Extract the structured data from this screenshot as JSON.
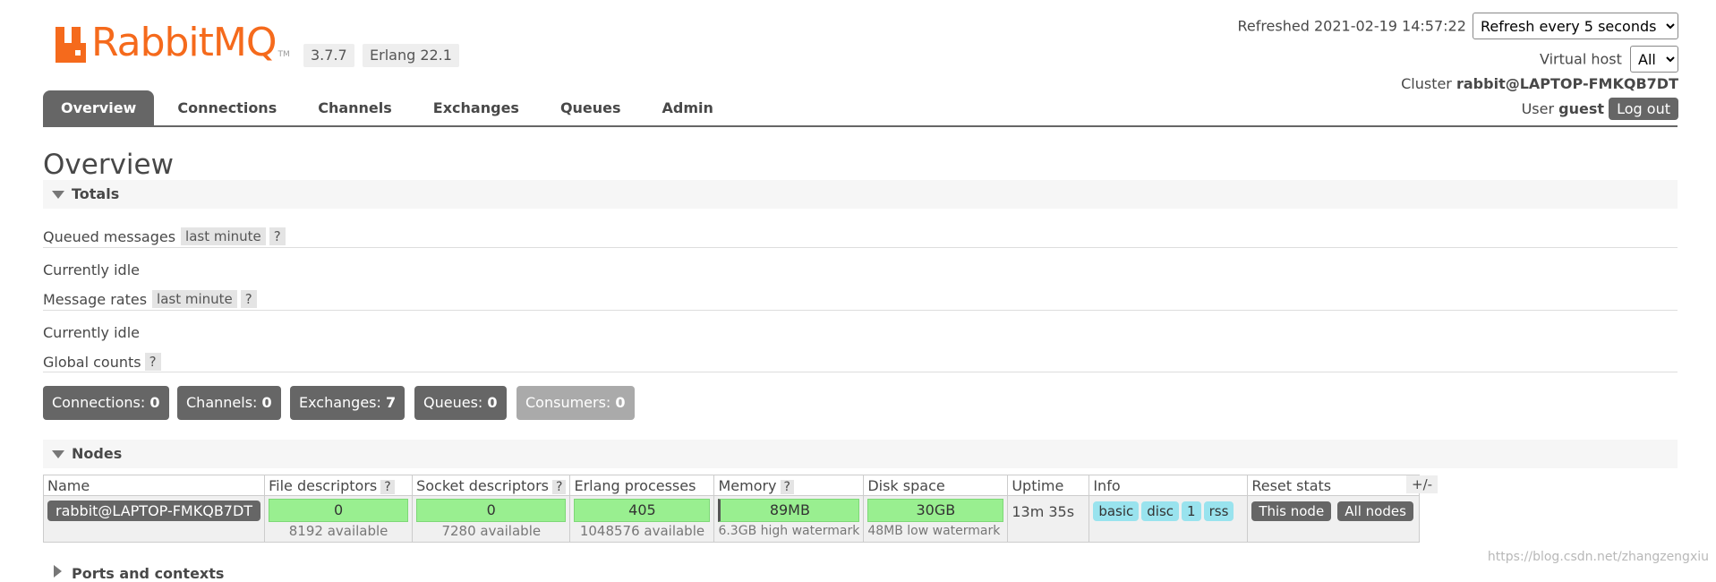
{
  "brand": {
    "name": "RabbitMQ",
    "tm": "TM",
    "version": "3.7.7",
    "erlang": "Erlang 22.1",
    "color": "#f56a1c"
  },
  "header": {
    "refreshed_label": "Refreshed",
    "refreshed_time": "2021-02-19 14:57:22",
    "refresh_select": "Refresh every 5 seconds",
    "vhost_label": "Virtual host",
    "vhost_select": "All",
    "cluster_label": "Cluster",
    "cluster_name": "rabbit@LAPTOP-FMKQB7DT",
    "user_label": "User",
    "user_name": "guest",
    "logout": "Log out"
  },
  "tabs": [
    "Overview",
    "Connections",
    "Channels",
    "Exchanges",
    "Queues",
    "Admin"
  ],
  "page_title": "Overview",
  "totals": {
    "title": "Totals",
    "queued_messages": "Queued messages",
    "queued_range": "last minute",
    "queued_help": "?",
    "queued_status": "Currently idle",
    "message_rates": "Message rates",
    "rates_range": "last minute",
    "rates_help": "?",
    "rates_status": "Currently idle",
    "global_counts": "Global counts",
    "global_help": "?",
    "counts": [
      {
        "label": "Connections:",
        "value": "0"
      },
      {
        "label": "Channels:",
        "value": "0"
      },
      {
        "label": "Exchanges:",
        "value": "7"
      },
      {
        "label": "Queues:",
        "value": "0"
      },
      {
        "label": "Consumers:",
        "value": "0"
      }
    ]
  },
  "nodes": {
    "title": "Nodes",
    "plus_minus": "+/-",
    "headers": {
      "name": "Name",
      "fd": "File descriptors",
      "sock": "Socket descriptors",
      "erl": "Erlang processes",
      "mem": "Memory",
      "disk": "Disk space",
      "uptime": "Uptime",
      "info": "Info",
      "reset": "Reset stats",
      "help": "?"
    },
    "row": {
      "name": "rabbit@LAPTOP-FMKQB7DT",
      "fd": "0",
      "fd_sub": "8192 available",
      "sock": "0",
      "sock_sub": "7280 available",
      "erl": "405",
      "erl_sub": "1048576 available",
      "mem": "89MB",
      "mem_sub": "6.3GB high watermark",
      "disk": "30GB",
      "disk_sub": "48MB low watermark",
      "uptime": "13m 35s",
      "info": [
        "basic",
        "disc",
        "1",
        "rss"
      ],
      "reset_this": "This node",
      "reset_all": "All nodes"
    }
  },
  "ports": {
    "title": "Ports and contexts"
  },
  "watermark": "https://blog.csdn.net/zhangzengxiu"
}
